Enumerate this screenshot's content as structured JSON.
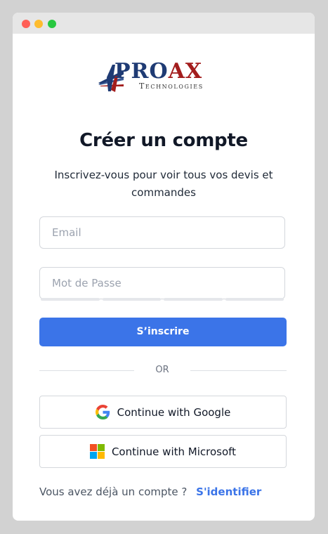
{
  "window": {
    "controls": [
      "close",
      "minimize",
      "maximize"
    ]
  },
  "logo": {
    "brand_pro": "PRO",
    "brand_ax": "AX",
    "subline": "Technologies",
    "colors": {
      "navy": "#1f3b74",
      "red": "#a31d1d"
    }
  },
  "page": {
    "title": "Créer un compte",
    "subtitle": "Inscrivez-vous pour voir tous vos devis et commandes"
  },
  "form": {
    "email_placeholder": "Email",
    "email_value": "",
    "password_placeholder": "Mot de Passe",
    "password_value": "",
    "submit_label": "S’inscrire"
  },
  "divider": {
    "label": "OR"
  },
  "oauth": {
    "google_label": "Continue with Google",
    "microsoft_label": "Continue with Microsoft",
    "google_icon": "google-icon",
    "microsoft_icon": "microsoft-icon"
  },
  "footer": {
    "question": "Vous avez déjà un compte ?",
    "signin_label": "S'identifier"
  },
  "colors": {
    "accent": "#3b74e8",
    "background": "#d2d2d2",
    "card": "#ffffff",
    "title_text": "#111827"
  }
}
